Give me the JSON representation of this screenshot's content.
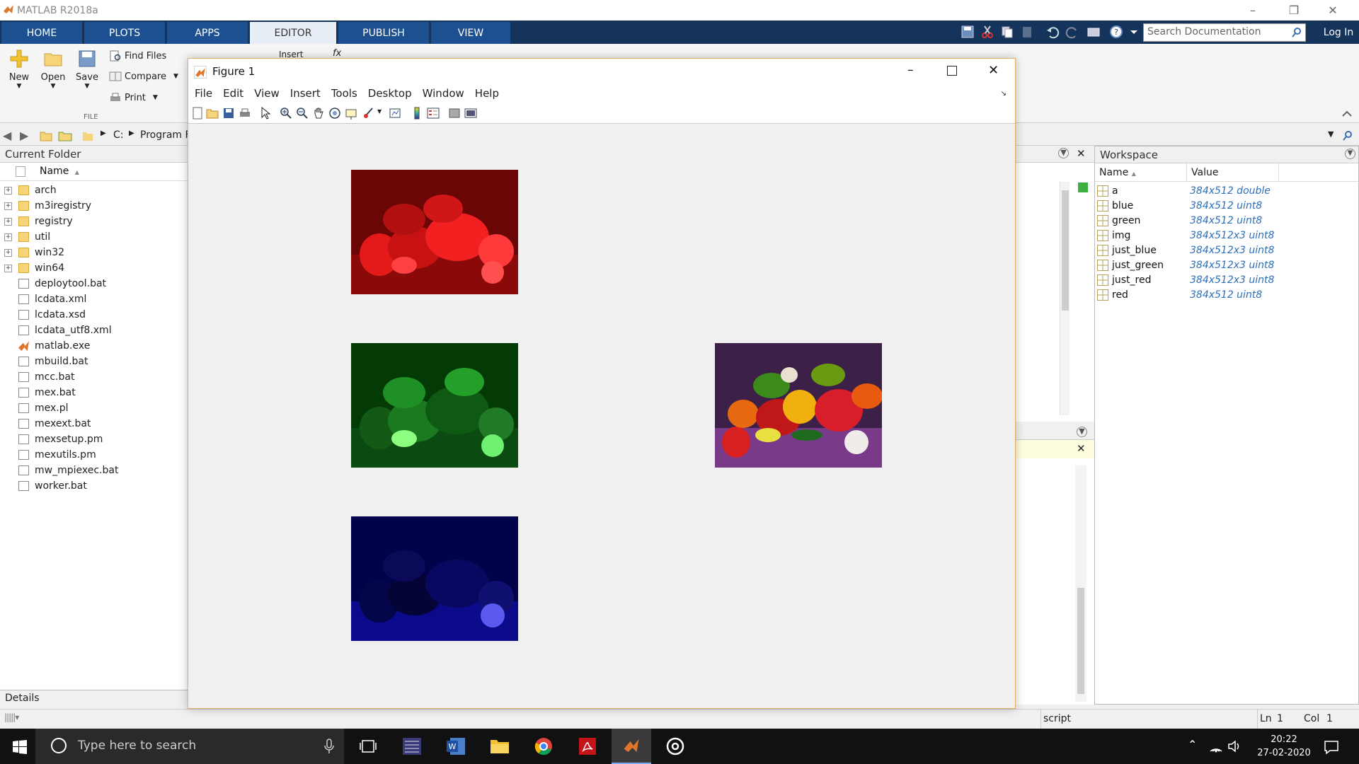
{
  "window": {
    "title": "MATLAB R2018a"
  },
  "ribbon_tabs": [
    {
      "label": "HOME"
    },
    {
      "label": "PLOTS"
    },
    {
      "label": "APPS"
    },
    {
      "label": "EDITOR"
    },
    {
      "label": "PUBLISH"
    },
    {
      "label": "VIEW"
    }
  ],
  "active_tab": "EDITOR",
  "search": {
    "placeholder": "Search Documentation"
  },
  "login_label": "Log In",
  "ribbon": {
    "new_label": "New",
    "open_label": "Open",
    "save_label": "Save",
    "find_files_label": "Find Files",
    "compare_label": "Compare",
    "print_label": "Print",
    "section_file": "FILE",
    "insert_label": "Insert",
    "fx_label": "fx"
  },
  "address": {
    "drive": "C:",
    "path": "Program F"
  },
  "current_folder": {
    "title": "Current Folder",
    "name_header": "Name",
    "items": [
      {
        "name": "arch",
        "type": "folder"
      },
      {
        "name": "m3iregistry",
        "type": "folder"
      },
      {
        "name": "registry",
        "type": "folder"
      },
      {
        "name": "util",
        "type": "folder"
      },
      {
        "name": "win32",
        "type": "folder"
      },
      {
        "name": "win64",
        "type": "folder"
      },
      {
        "name": "deploytool.bat",
        "type": "file"
      },
      {
        "name": "lcdata.xml",
        "type": "file"
      },
      {
        "name": "lcdata.xsd",
        "type": "file"
      },
      {
        "name": "lcdata_utf8.xml",
        "type": "file"
      },
      {
        "name": "matlab.exe",
        "type": "exe"
      },
      {
        "name": "mbuild.bat",
        "type": "file"
      },
      {
        "name": "mcc.bat",
        "type": "file"
      },
      {
        "name": "mex.bat",
        "type": "file"
      },
      {
        "name": "mex.pl",
        "type": "file"
      },
      {
        "name": "mexext.bat",
        "type": "file"
      },
      {
        "name": "mexsetup.pm",
        "type": "file"
      },
      {
        "name": "mexutils.pm",
        "type": "file"
      },
      {
        "name": "mw_mpiexec.bat",
        "type": "file"
      },
      {
        "name": "worker.bat",
        "type": "file"
      }
    ],
    "details_label": "Details"
  },
  "workspace": {
    "title": "Workspace",
    "name_header": "Name",
    "value_header": "Value",
    "variables": [
      {
        "name": "a",
        "value": "384x512 double"
      },
      {
        "name": "blue",
        "value": "384x512 uint8"
      },
      {
        "name": "green",
        "value": "384x512 uint8"
      },
      {
        "name": "img",
        "value": "384x512x3 uint8"
      },
      {
        "name": "just_blue",
        "value": "384x512x3 uint8"
      },
      {
        "name": "just_green",
        "value": "384x512x3 uint8"
      },
      {
        "name": "just_red",
        "value": "384x512x3 uint8"
      },
      {
        "name": "red",
        "value": "384x512 uint8"
      }
    ]
  },
  "figure": {
    "title": "Figure 1",
    "menu": [
      "File",
      "Edit",
      "View",
      "Insert",
      "Tools",
      "Desktop",
      "Window",
      "Help"
    ],
    "subplots": [
      {
        "name": "red-channel",
        "color": "#c01010"
      },
      {
        "name": "green-channel",
        "color": "#0f7a12"
      },
      {
        "name": "blue-channel",
        "color": "#0a0a6a"
      },
      {
        "name": "original",
        "color": "#6a2e6a"
      }
    ]
  },
  "statusbar": {
    "mode": "script",
    "ln_label": "Ln",
    "ln_value": "1",
    "col_label": "Col",
    "col_value": "1"
  },
  "taskbar": {
    "search_placeholder": "Type here to search",
    "time": "20:22",
    "date": "27-02-2020"
  }
}
